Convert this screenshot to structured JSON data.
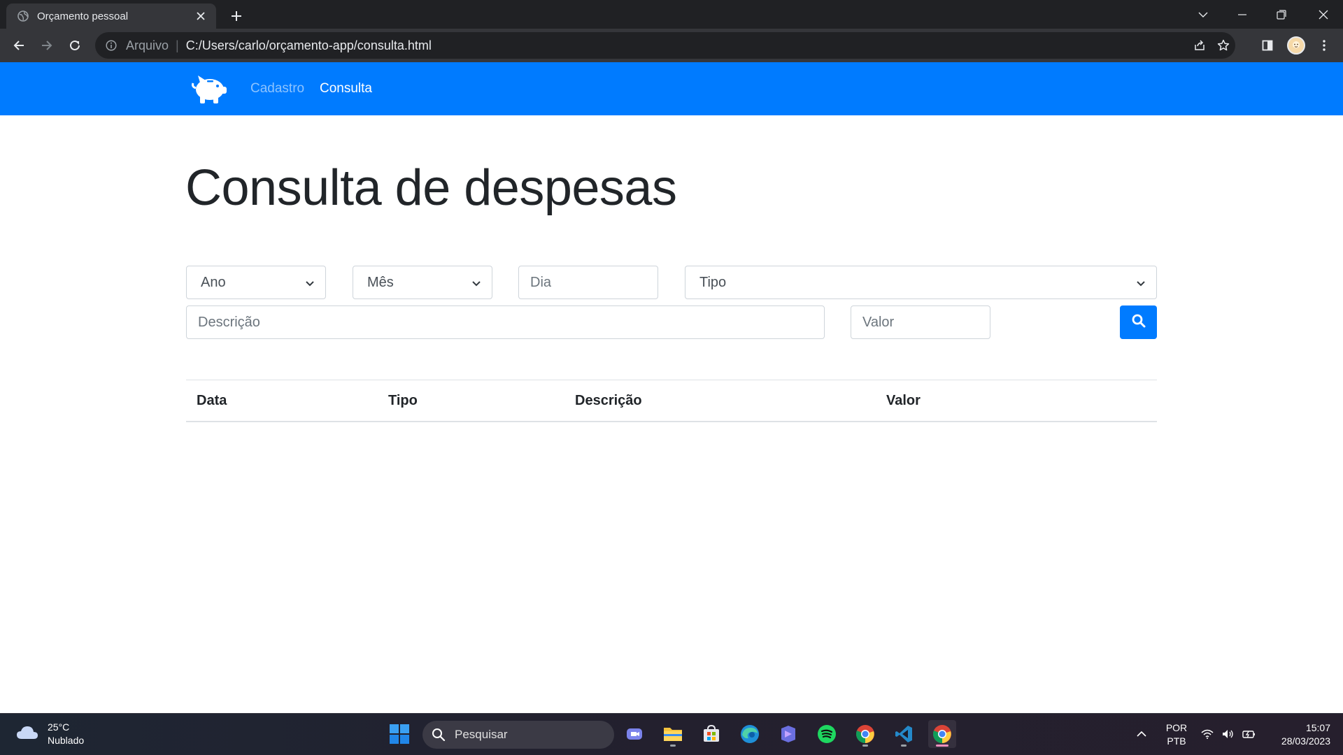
{
  "browser": {
    "tab_title": "Orçamento pessoal",
    "url_protocol": "Arquivo",
    "url": "C:/Users/carlo/orçamento-app/consulta.html"
  },
  "nav": {
    "brand_icon": "piggy-bank-icon",
    "links": [
      {
        "label": "Cadastro",
        "active": false
      },
      {
        "label": "Consulta",
        "active": true
      }
    ]
  },
  "page": {
    "heading": "Consulta de despesas",
    "filters": {
      "ano": "Ano",
      "mes": "Mês",
      "dia_placeholder": "Dia",
      "tipo": "Tipo",
      "descricao_placeholder": "Descrição",
      "valor_placeholder": "Valor"
    },
    "table": {
      "headers": [
        "Data",
        "Tipo",
        "Descrição",
        "Valor"
      ],
      "rows": []
    }
  },
  "taskbar": {
    "weather": {
      "temp": "25°C",
      "condition": "Nublado"
    },
    "search_placeholder": "Pesquisar",
    "language": {
      "line1": "POR",
      "line2": "PTB"
    },
    "time": "15:07",
    "date": "28/03/2023"
  },
  "colors": {
    "primary": "#007bff",
    "chrome_dark": "#202124",
    "chrome_toolbar": "#35363a"
  }
}
